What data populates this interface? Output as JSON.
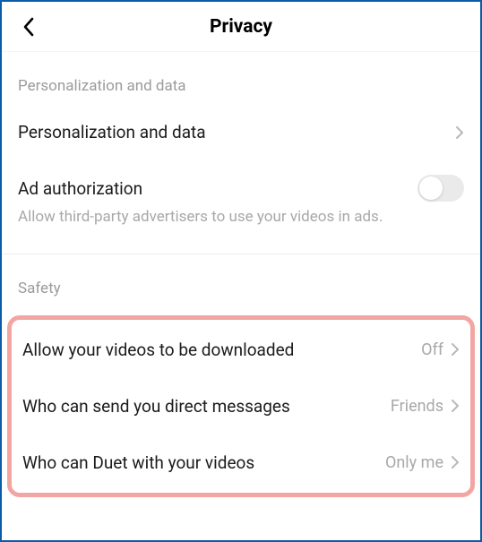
{
  "header": {
    "title": "Privacy"
  },
  "sections": {
    "personalization": {
      "header": "Personalization and data",
      "item_label": "Personalization and data",
      "ad_label": "Ad authorization",
      "ad_description": "Allow third-party advertisers to use your videos in ads."
    },
    "safety": {
      "header": "Safety",
      "items": [
        {
          "label": "Allow your videos to be downloaded",
          "value": "Off"
        },
        {
          "label": "Who can send you direct messages",
          "value": "Friends"
        },
        {
          "label": "Who can Duet with your videos",
          "value": "Only me"
        }
      ]
    }
  }
}
